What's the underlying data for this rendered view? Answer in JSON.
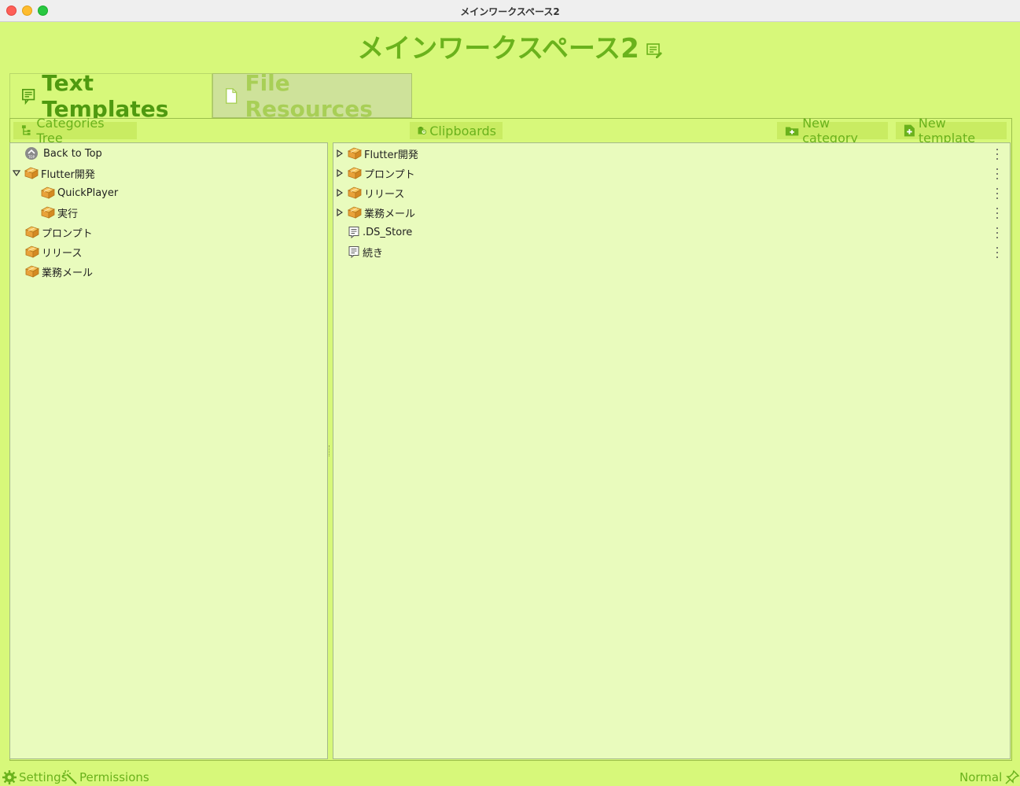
{
  "window": {
    "title": "メインワークスペース2"
  },
  "workspace": {
    "title": "メインワークスペース2"
  },
  "tabs": [
    {
      "label": "Text Templates",
      "active": true
    },
    {
      "label": "File Resources",
      "active": false
    }
  ],
  "toolbar": {
    "categories_tree": "Categories Tree",
    "clipboards": "Clipboards",
    "new_category": "New category",
    "new_template": "New template"
  },
  "tree": {
    "back_to_top": "Back to Top",
    "items": [
      {
        "label": "Flutter開発",
        "expanded": true
      },
      {
        "label": "QuickPlayer"
      },
      {
        "label": "実行"
      },
      {
        "label": "プロンプト"
      },
      {
        "label": "リリース"
      },
      {
        "label": "業務メール"
      }
    ]
  },
  "list": {
    "items": [
      {
        "label": "Flutter開発",
        "kind": "folder"
      },
      {
        "label": "プロンプト",
        "kind": "folder"
      },
      {
        "label": "リリース",
        "kind": "folder"
      },
      {
        "label": "業務メール",
        "kind": "folder"
      },
      {
        "label": ".DS_Store",
        "kind": "template"
      },
      {
        "label": "続き",
        "kind": "template"
      }
    ]
  },
  "status": {
    "settings": "Settings",
    "permissions": "Permissions",
    "mode": "Normal"
  },
  "colors": {
    "background": "#d7f87a",
    "panel": "#e9fbbd",
    "accent": "#6ab21c",
    "folder": "#e8a23a"
  }
}
